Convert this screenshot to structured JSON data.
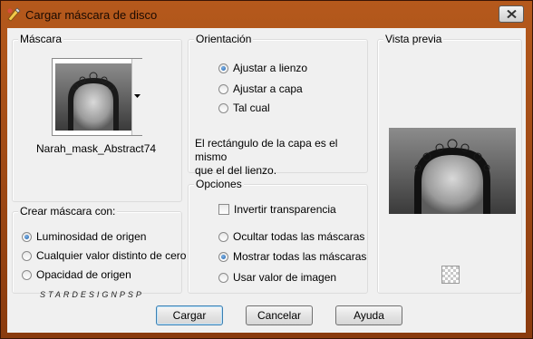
{
  "window": {
    "title": "Cargar máscara de disco"
  },
  "mask_group": {
    "label": "Máscara",
    "mask_name": "Narah_mask_Abstract74"
  },
  "create_group": {
    "label": "Crear máscara con:",
    "options": [
      {
        "label": "Luminosidad de origen",
        "selected": true
      },
      {
        "label": "Cualquier valor distinto de cero",
        "selected": false
      },
      {
        "label": "Opacidad de origen",
        "selected": false
      }
    ]
  },
  "orientation_group": {
    "label": "Orientación",
    "options": [
      {
        "label": "Ajustar a lienzo",
        "selected": true
      },
      {
        "label": "Ajustar a capa",
        "selected": false
      },
      {
        "label": "Tal cual",
        "selected": false
      }
    ],
    "description": [
      "El rectángulo de la capa es el mismo",
      "que el del lienzo."
    ]
  },
  "options_group": {
    "label": "Opciones",
    "invert_label": "Invertir transparencia",
    "invert_checked": false,
    "options": [
      {
        "label": "Ocultar todas las máscaras",
        "selected": false
      },
      {
        "label": "Mostrar todas las máscaras",
        "selected": true
      },
      {
        "label": "Usar valor de imagen",
        "selected": false
      }
    ]
  },
  "preview_group": {
    "label": "Vista previa"
  },
  "watermark": "STARDESIGNPSP",
  "buttons": {
    "load": "Cargar",
    "cancel": "Cancelar",
    "help": "Ayuda"
  },
  "colors": {
    "frame": "#b5591c",
    "accent_radio": "#1f5fa8"
  }
}
